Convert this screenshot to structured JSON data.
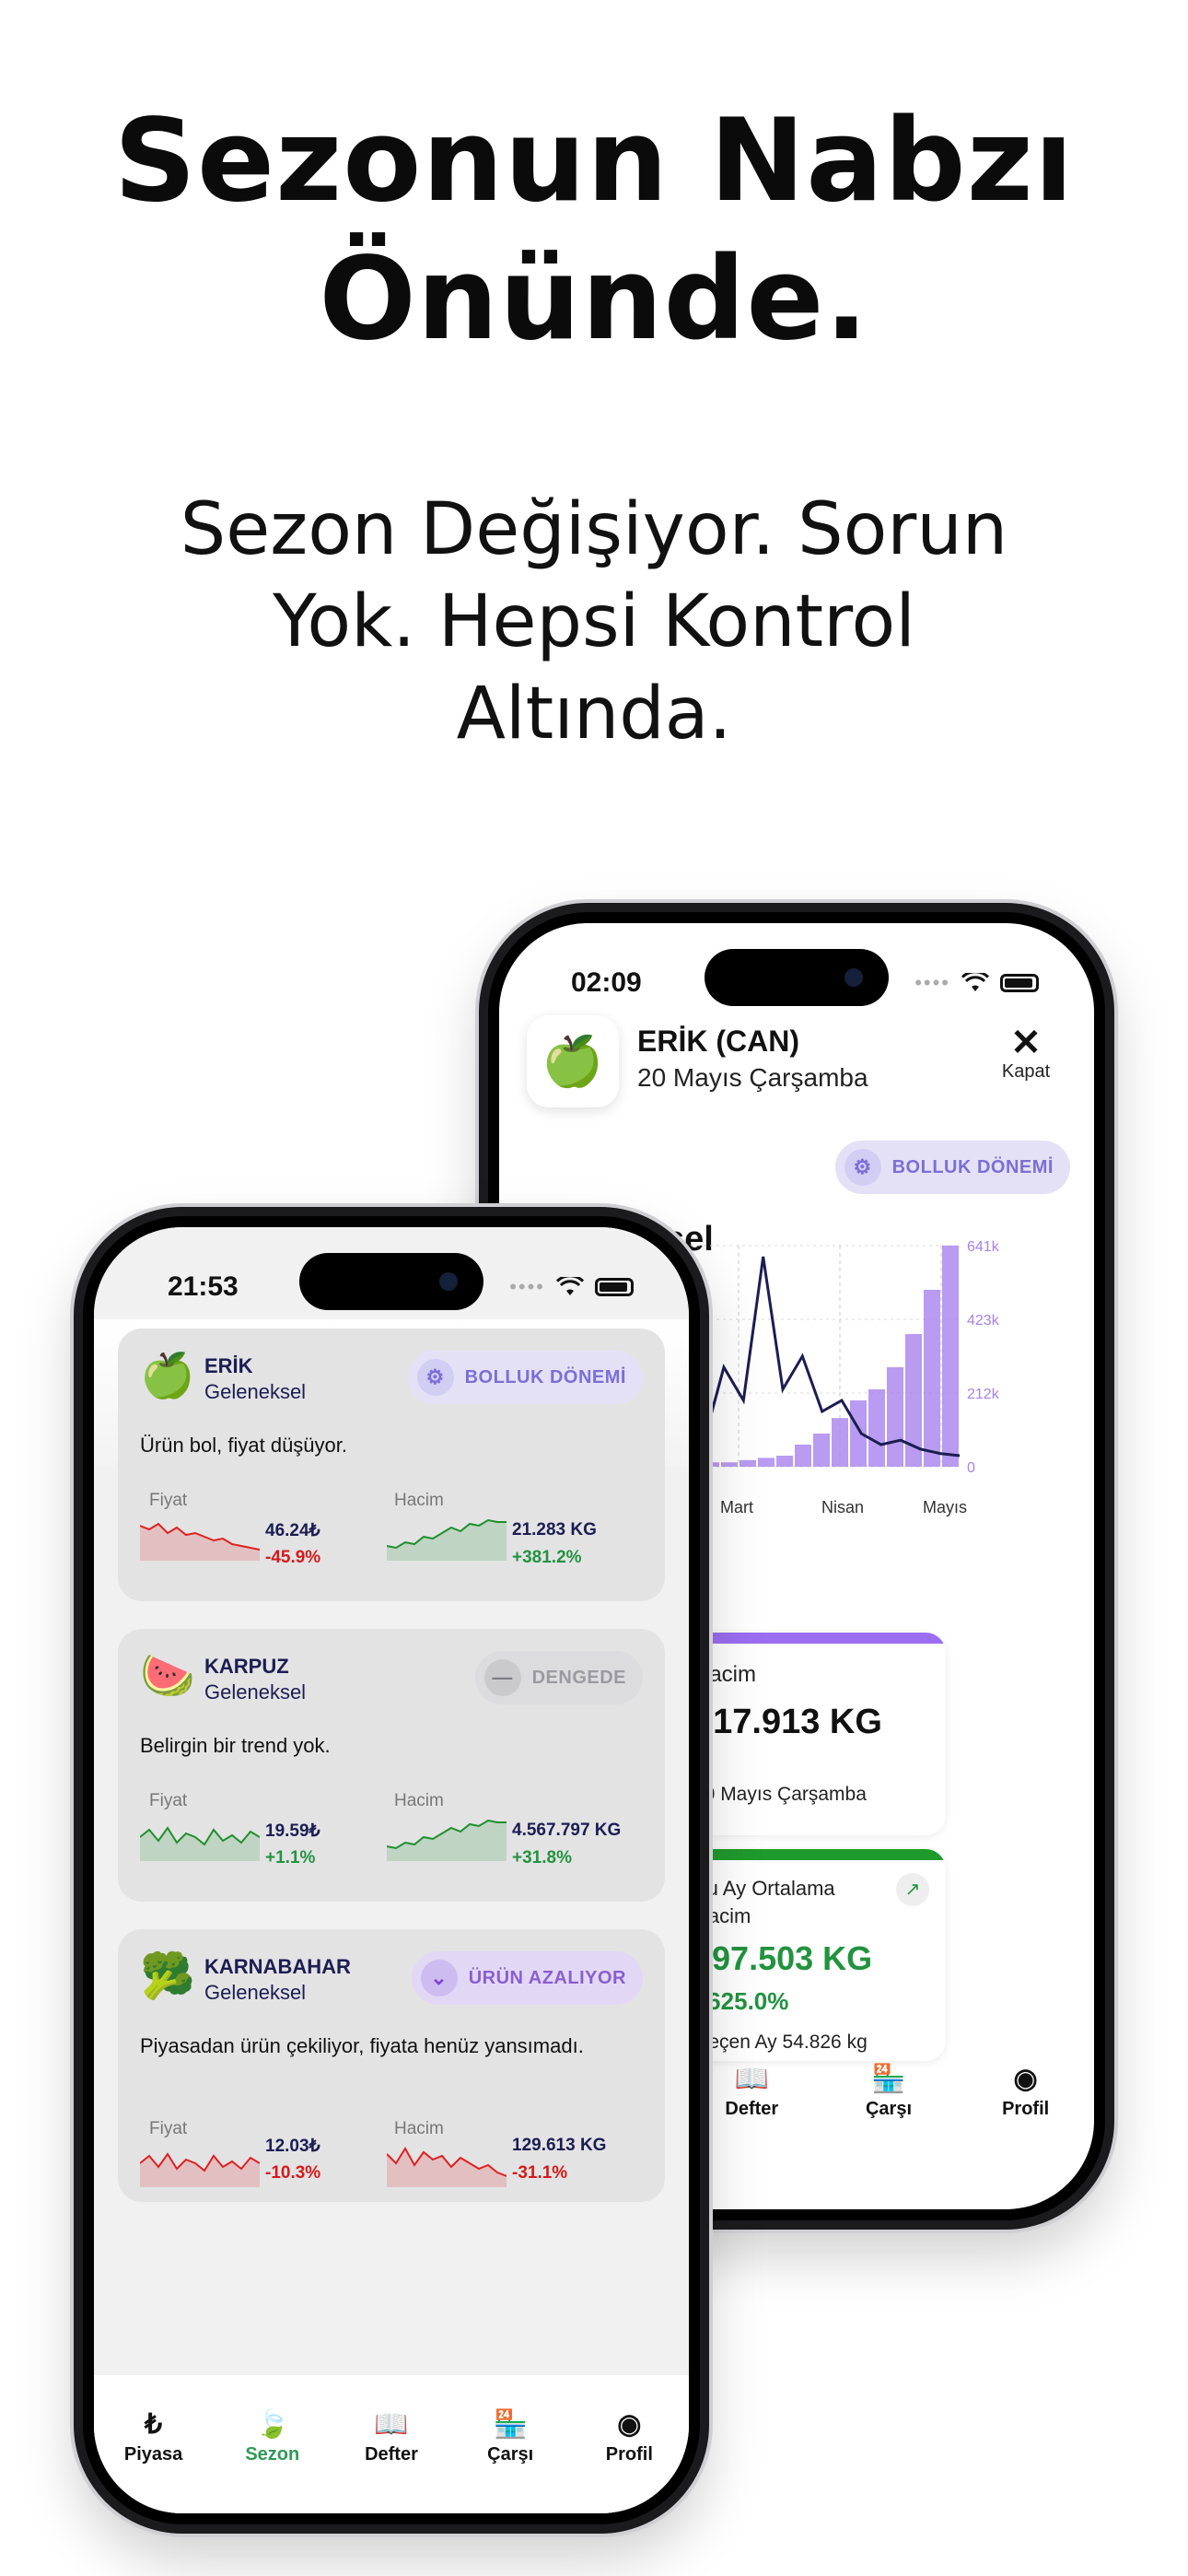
{
  "headline": [
    "Sezonun Nabzı",
    "Önünde."
  ],
  "subhead": [
    "Sezon Değişiyor. Sorun",
    "Yok. Hepsi Kontrol",
    "Altında."
  ],
  "back_phone": {
    "status_time": "02:09",
    "product_title": "ERİK (CAN)",
    "product_date": "20 Mayıs Çarşamba",
    "close_label": "Kapat",
    "badge_label": "BOLLUK DÖNEMİ",
    "section_title_fragment": "sel",
    "chart_data": {
      "type": "line",
      "x_labels": [
        "Mart",
        "Nisan",
        "Mayıs"
      ],
      "y_right_ticks": [
        "641k",
        "423k",
        "212k",
        "0"
      ],
      "series": [
        {
          "values": [
            0.1,
            0.18,
            0.12,
            0.45,
            0.3,
            0.95,
            0.35,
            0.5,
            0.25,
            0.3,
            0.15,
            0.1,
            0.12,
            0.08,
            0.06,
            0.05
          ]
        },
        {
          "values": [
            0.01,
            0.01,
            0.02,
            0.02,
            0.03,
            0.04,
            0.05,
            0.1,
            0.15,
            0.22,
            0.3,
            0.35,
            0.45,
            0.6,
            0.8,
            1.0
          ]
        }
      ]
    },
    "card_volume": {
      "title": "Hacim",
      "value": "617.913 KG",
      "footer": "20 Mayıs Çarşamba",
      "left_fragment": "a"
    },
    "card_avg": {
      "title": "Bu Ay Ortalama Hacim",
      "value": "397.503 KG",
      "change": "+625.0%",
      "footer": "Geçen Ay 54.826 kg"
    },
    "tabs": [
      {
        "label": "Defter",
        "icon": "book-icon"
      },
      {
        "label": "Çarşı",
        "icon": "store-icon"
      },
      {
        "label": "Profil",
        "icon": "profile-icon"
      }
    ]
  },
  "front_phone": {
    "status_time": "21:53",
    "items": [
      {
        "name": "ERİK",
        "type": "Geleneksel",
        "emoji": "🍏",
        "badge": "BOLLUK DÖNEMİ",
        "badge_style": "purple",
        "badge_icon": "gear-icon",
        "desc": "Ürün bol, fiyat düşüyor.",
        "price_label": "Fiyat",
        "price": "46.24₺",
        "price_change": "-45.9%",
        "price_dir": "down",
        "volume_label": "Hacim",
        "volume": "21.283 KG",
        "volume_change": "+381.2%",
        "volume_dir": "up"
      },
      {
        "name": "KARPUZ",
        "type": "Geleneksel",
        "emoji": "🍉",
        "badge": "DENGEDE",
        "badge_style": "grey",
        "badge_icon": "minus-icon",
        "desc": "Belirgin bir trend yok.",
        "price_label": "Fiyat",
        "price": "19.59₺",
        "price_change": "+1.1%",
        "price_dir": "up",
        "volume_label": "Hacim",
        "volume": "4.567.797 KG",
        "volume_change": "+31.8%",
        "volume_dir": "up"
      },
      {
        "name": "KARNABAHAR",
        "type": "Geleneksel",
        "emoji": "🥦",
        "badge": "ÜRÜN AZALIYOR",
        "badge_style": "lav",
        "badge_icon": "chevron-down-icon",
        "desc": "Piyasadan ürün çekiliyor, fiyata henüz yansımadı.",
        "price_label": "Fiyat",
        "price": "12.03₺",
        "price_change": "-10.3%",
        "price_dir": "down",
        "volume_label": "Hacim",
        "volume": "129.613 KG",
        "volume_change": "-31.1%",
        "volume_dir": "down"
      }
    ],
    "tabs": [
      {
        "label": "Piyasa",
        "icon": "lira-icon",
        "active": false
      },
      {
        "label": "Sezon",
        "icon": "leaf-icon",
        "active": true
      },
      {
        "label": "Defter",
        "icon": "book-icon",
        "active": false
      },
      {
        "label": "Çarşı",
        "icon": "store-icon",
        "active": false
      },
      {
        "label": "Profil",
        "icon": "profile-icon",
        "active": false
      }
    ]
  }
}
